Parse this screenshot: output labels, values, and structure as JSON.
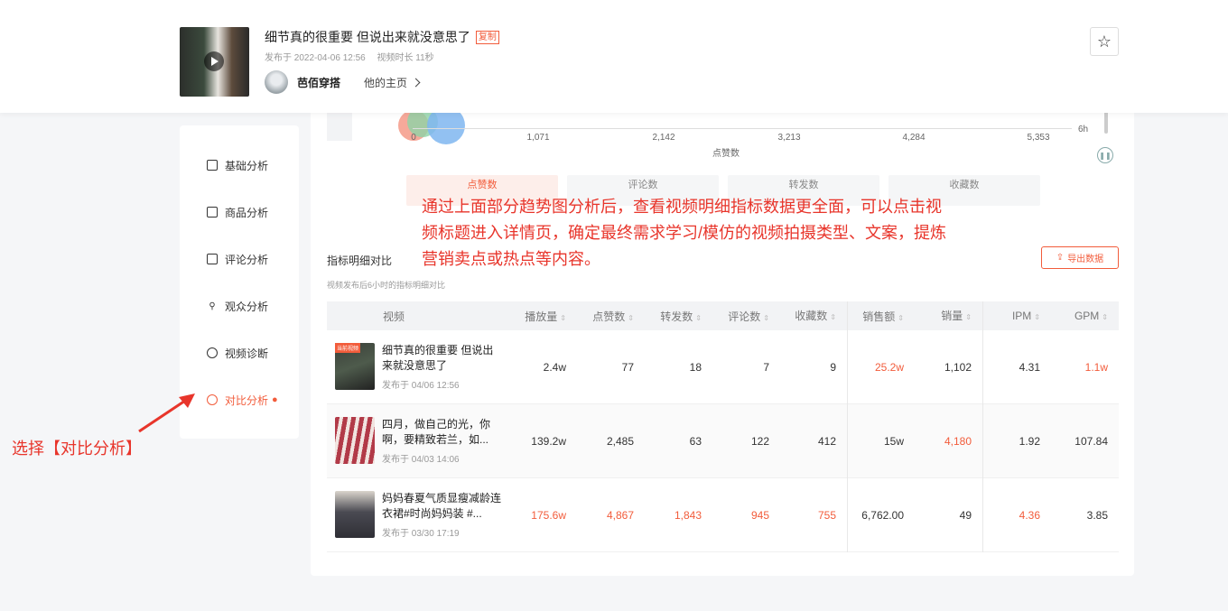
{
  "header": {
    "title": "细节真的很重要 但说出来就没意思了",
    "copy_label": "复制",
    "publish_time": "发布于 2022-04-06 12:56",
    "duration": "视频时长 11秒",
    "author_name": "芭佰穿搭",
    "home_link": "他的主页",
    "star_icon": "star-icon"
  },
  "sidebar": {
    "items": [
      {
        "label": "基础分析",
        "icon": "chart-icon"
      },
      {
        "label": "商品分析",
        "icon": "bag-icon"
      },
      {
        "label": "评论分析",
        "icon": "comment-icon"
      },
      {
        "label": "观众分析",
        "icon": "user-icon"
      },
      {
        "label": "视频诊断",
        "icon": "play-circle-icon"
      },
      {
        "label": "对比分析",
        "icon": "play-circle-icon",
        "active": true
      }
    ]
  },
  "chart": {
    "ticks": [
      "0",
      "1,071",
      "2,142",
      "3,213",
      "4,284",
      "5,353"
    ],
    "x_title": "点赞数",
    "time_label": "6h",
    "bubble_label": "0",
    "colors": {
      "bubble_red": "#f3a08c",
      "bubble_green": "#8fd3a6",
      "bubble_blue": "#7fb6f0"
    }
  },
  "metric_tabs": [
    {
      "label": "点赞数",
      "active": true
    },
    {
      "label": "评论数"
    },
    {
      "label": "转发数"
    },
    {
      "label": "收藏数"
    }
  ],
  "section": {
    "title": "指标明细对比",
    "subtitle": "视频发布后6小时的指标明细对比",
    "export_label": "导出数据"
  },
  "table": {
    "headers": [
      "视频",
      "播放量",
      "点赞数",
      "转发数",
      "评论数",
      "收藏数",
      "销售额",
      "销量",
      "IPM",
      "GPM"
    ],
    "rows": [
      {
        "tag": "当前视频",
        "title": "细节真的很重要 但说出来就没意思了",
        "date": "发布于 04/06 12:56",
        "play": "2.4w",
        "like": "77",
        "share": "18",
        "comment": "7",
        "fav": "9",
        "sales": "25.2w",
        "qty": "1,102",
        "ipm": "4.31",
        "gpm": "1.1w"
      },
      {
        "tag": "",
        "title": "四月，做自己的光，你啊，要精致若兰，如...",
        "date": "发布于 04/03 14:06",
        "play": "139.2w",
        "like": "2,485",
        "share": "63",
        "comment": "122",
        "fav": "412",
        "sales": "15w",
        "qty": "4,180",
        "ipm": "1.92",
        "gpm": "107.84"
      },
      {
        "tag": "",
        "title": "妈妈春夏气质显瘦减龄连衣裙#时尚妈妈装 #...",
        "date": "发布于 03/30 17:19",
        "play": "175.6w",
        "like": "4,867",
        "share": "1,843",
        "comment": "945",
        "fav": "755",
        "sales": "6,762.00",
        "qty": "49",
        "ipm": "4.36",
        "gpm": "3.85"
      }
    ]
  },
  "annotations": {
    "main_lines": [
      "通过上面部分趋势图分析后，查看视频明细指标数据更全面，可以点击视",
      "频标题进入详情页，确定最终需求学习/模仿的视频拍摄类型、文案，提炼",
      "营销卖点或热点等内容。"
    ],
    "callout": "选择【对比分析】",
    "color": "#e8352b"
  },
  "accent_color": "#f25c3b"
}
